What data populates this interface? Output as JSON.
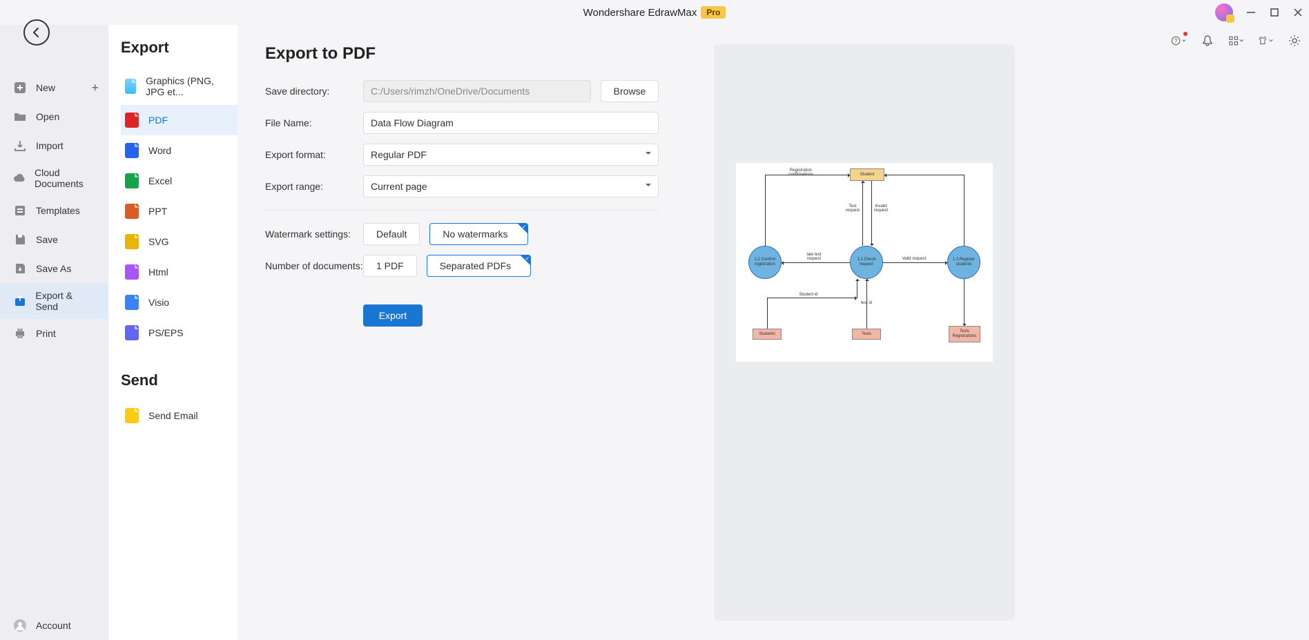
{
  "app": {
    "title": "Wondershare EdrawMax",
    "badge": "Pro"
  },
  "nav": {
    "items": [
      {
        "id": "new",
        "label": "New",
        "hasPlus": true
      },
      {
        "id": "open",
        "label": "Open"
      },
      {
        "id": "import",
        "label": "Import"
      },
      {
        "id": "cloud",
        "label": "Cloud Documents"
      },
      {
        "id": "templates",
        "label": "Templates"
      },
      {
        "id": "save",
        "label": "Save"
      },
      {
        "id": "saveas",
        "label": "Save As"
      },
      {
        "id": "exportsend",
        "label": "Export & Send",
        "active": true
      },
      {
        "id": "print",
        "label": "Print"
      }
    ],
    "account": "Account"
  },
  "export": {
    "heading": "Export",
    "items": [
      {
        "id": "graphics",
        "label": "Graphics (PNG, JPG et...",
        "cls": "fi-img"
      },
      {
        "id": "pdf",
        "label": "PDF",
        "cls": "fi-pdf",
        "selected": true
      },
      {
        "id": "word",
        "label": "Word",
        "cls": "fi-word"
      },
      {
        "id": "excel",
        "label": "Excel",
        "cls": "fi-xls"
      },
      {
        "id": "ppt",
        "label": "PPT",
        "cls": "fi-ppt"
      },
      {
        "id": "svg",
        "label": "SVG",
        "cls": "fi-svg"
      },
      {
        "id": "html",
        "label": "Html",
        "cls": "fi-html"
      },
      {
        "id": "visio",
        "label": "Visio",
        "cls": "fi-visio"
      },
      {
        "id": "ps",
        "label": "PS/EPS",
        "cls": "fi-ps"
      }
    ],
    "sendHeading": "Send",
    "sendItems": [
      {
        "id": "email",
        "label": "Send Email",
        "cls": "fi-mail"
      }
    ]
  },
  "form": {
    "title": "Export to PDF",
    "labels": {
      "saveDir": "Save directory:",
      "fileName": "File Name:",
      "format": "Export format:",
      "range": "Export range:",
      "watermark": "Watermark settings:",
      "numDocs": "Number of documents:"
    },
    "values": {
      "saveDir": "C:/Users/rimzh/OneDrive/Documents",
      "fileName": "Data Flow Diagram",
      "format": "Regular PDF",
      "range": "Current page",
      "wmDefault": "Default",
      "wmNone": "No watermarks",
      "onePdf": "1 PDF",
      "sepPdf": "Separated PDFs"
    },
    "buttons": {
      "browse": "Browse",
      "export": "Export"
    }
  },
  "diagram": {
    "entities": {
      "student": "Student",
      "confirm": "1.2 Confirm registration",
      "check": "1.1 Check request",
      "register": "1.3 Register students",
      "students": "Students",
      "tests": "Tests",
      "testsReg": "Tests Registrations"
    },
    "flows": {
      "regConf": "Registration confirmations",
      "testReq": "Test request",
      "invalidReq": "Invalid request",
      "lateReq": "late test request",
      "validReq": "Valid request",
      "studentId": "Student id",
      "testId": "test id"
    }
  }
}
